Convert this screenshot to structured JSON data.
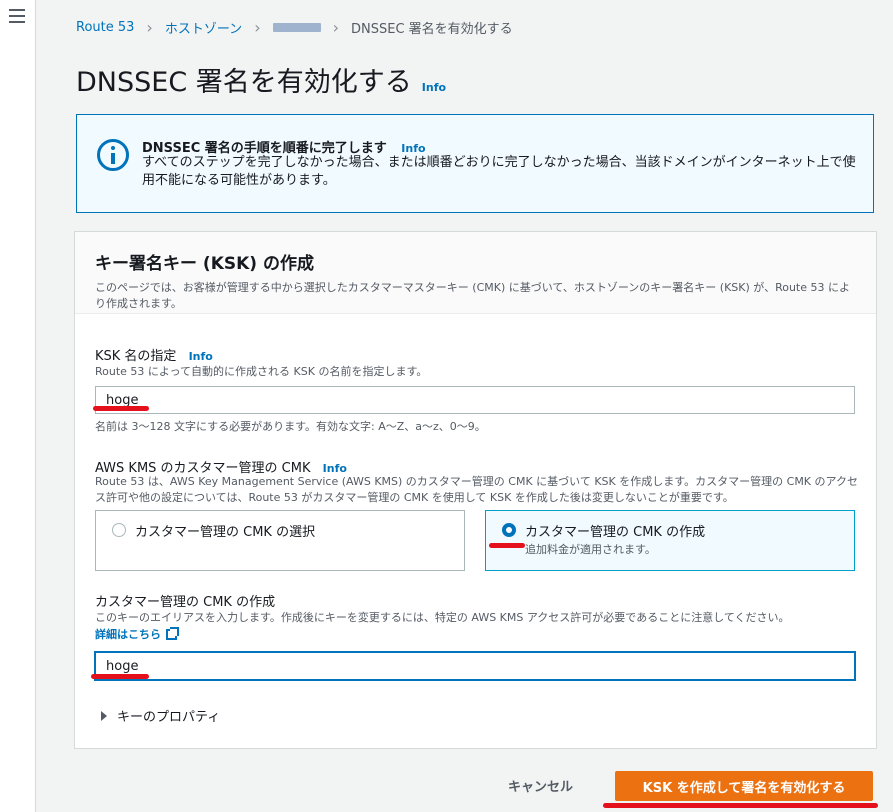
{
  "breadcrumb": {
    "route53": "Route 53",
    "hosted_zones": "ホストゾーン",
    "current": "DNSSEC 署名を有効化する"
  },
  "page": {
    "title": "DNSSEC 署名を有効化する",
    "info": "Info"
  },
  "alert": {
    "title": "DNSSEC 署名の手順を順番に完了します",
    "info": "Info",
    "body": "すべてのステップを完了しなかった場合、または順番どおりに完了しなかった場合、当該ドメインがインターネット上で使用不能になる可能性があります。"
  },
  "ksk_section": {
    "title": "キー署名キー (KSK) の作成",
    "description": "このページでは、お客様が管理する中から選択したカスタマーマスターキー (CMK) に基づいて、ホストゾーンのキー署名キー (KSK) が、Route 53 により作成されます。"
  },
  "ksk_name": {
    "label": "KSK 名の指定",
    "info": "Info",
    "description": "Route 53 によって自動的に作成される KSK の名前を指定します。",
    "value": "hoge",
    "constraint": "名前は 3～128 文字にする必要があります。有効な文字: A～Z、a～z、0～9。"
  },
  "cmk": {
    "label": "AWS KMS のカスタマー管理の CMK",
    "info": "Info",
    "description": "Route 53 は、AWS Key Management Service (AWS KMS) のカスタマー管理の CMK に基づいて KSK を作成します。カスタマー管理の CMK のアクセス許可や他の設定については、Route 53 がカスタマー管理の CMK を使用して KSK を作成した後は変更しないことが重要です。",
    "options": [
      {
        "label": "カスタマー管理の CMK の選択",
        "sub": ""
      },
      {
        "label": "カスタマー管理の CMK の作成",
        "sub": "追加料金が適用されます。"
      }
    ],
    "selected_index": 1
  },
  "create_cmk": {
    "label": "カスタマー管理の CMK の作成",
    "description": "このキーのエイリアスを入力します。作成後にキーを変更するには、特定の AWS KMS アクセス許可が必要であることに注意してください。",
    "learn_more": "詳細はこちら",
    "value": "hoge"
  },
  "key_properties": {
    "label": "キーのプロパティ"
  },
  "actions": {
    "cancel": "キャンセル",
    "submit": "KSK を作成して署名を有効化する"
  },
  "colors": {
    "accent": "#0073bb",
    "primary_button": "#ec7211",
    "annotation": "#e4101c"
  }
}
